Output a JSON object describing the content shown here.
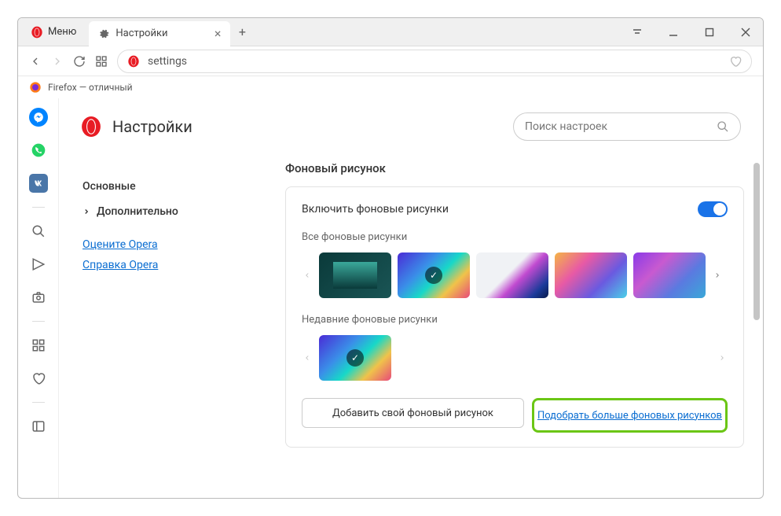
{
  "menu_label": "Меню",
  "tab": {
    "title": "Настройки"
  },
  "address": {
    "value": "settings"
  },
  "bookmark": {
    "label": "Firefox — отличный"
  },
  "page": {
    "title": "Настройки"
  },
  "search": {
    "placeholder": "Поиск настроек"
  },
  "sidenav": {
    "basic": "Основные",
    "advanced": "Дополнительно",
    "rate": "Оцените Opera",
    "help": "Справка Opera"
  },
  "section": {
    "title": "Фоновый рисунок",
    "enable": "Включить фоновые рисунки",
    "all": "Все фоновые рисунки",
    "recent": "Недавние фоновые рисунки",
    "add": "Добавить свой фоновый рисунок",
    "more": "Подобрать больше фоновых рисунков"
  }
}
